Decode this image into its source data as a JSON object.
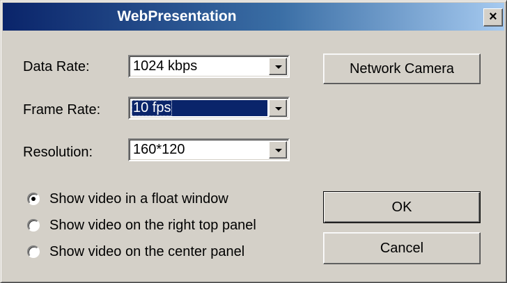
{
  "window": {
    "title": "WebPresentation",
    "close_glyph": "×",
    "close_icon": "close-icon"
  },
  "fields": {
    "data_rate": {
      "label": "Data Rate:",
      "value": "1024 kbps"
    },
    "frame_rate": {
      "label": "Frame Rate:",
      "value": "10 fps"
    },
    "resolution": {
      "label": "Resolution:",
      "value": "160*120"
    }
  },
  "buttons": {
    "network_camera": "Network Camera",
    "ok": "OK",
    "cancel": "Cancel"
  },
  "video_options": [
    {
      "label": "Show video in a float window",
      "checked": true
    },
    {
      "label": "Show video on the right top panel",
      "checked": false
    },
    {
      "label": "Show video on the center panel",
      "checked": false
    }
  ],
  "colors": {
    "face": "#d4d0c8",
    "title_start": "#0a246a",
    "title_end": "#a6caf0",
    "selection": "#0a246a"
  }
}
